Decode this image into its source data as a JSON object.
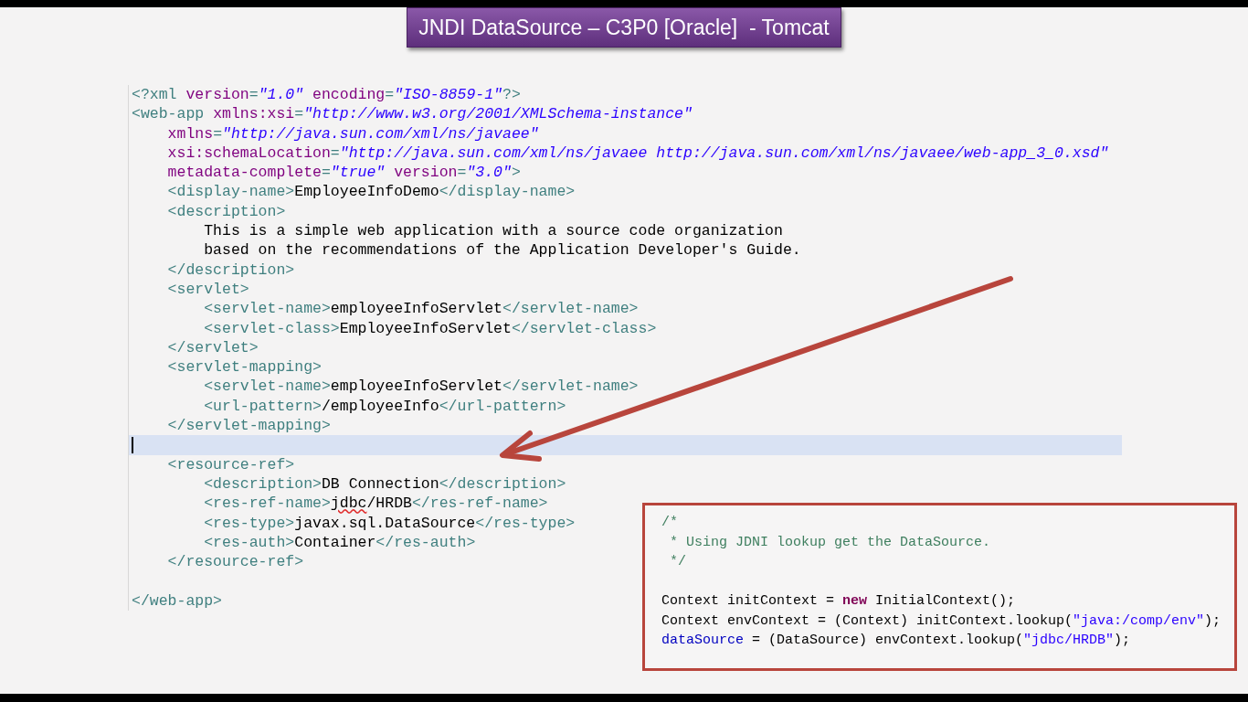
{
  "title": "JNDI DataSource – C3P0 [Oracle]  - Tomcat",
  "editor": {
    "lines": [
      {
        "current": false,
        "tokens": [
          {
            "kind": "tag",
            "text": "<?xml "
          },
          {
            "kind": "attr",
            "text": "version"
          },
          {
            "kind": "tag",
            "text": "="
          },
          {
            "kind": "string",
            "text": "\"1.0\""
          },
          {
            "kind": "attr",
            "text": " encoding"
          },
          {
            "kind": "tag",
            "text": "="
          },
          {
            "kind": "string",
            "text": "\"ISO-8859-1\""
          },
          {
            "kind": "tag",
            "text": "?>"
          }
        ]
      },
      {
        "current": false,
        "tokens": [
          {
            "kind": "tag",
            "text": "<web-app "
          },
          {
            "kind": "attr",
            "text": "xmlns:xsi"
          },
          {
            "kind": "tag",
            "text": "="
          },
          {
            "kind": "string",
            "text": "\"http://www.w3.org/2001/XMLSchema-instance\""
          }
        ]
      },
      {
        "current": false,
        "tokens": [
          {
            "kind": "attr",
            "text": "    xmlns"
          },
          {
            "kind": "tag",
            "text": "="
          },
          {
            "kind": "string",
            "text": "\"http://java.sun.com/xml/ns/javaee\""
          }
        ]
      },
      {
        "current": false,
        "tokens": [
          {
            "kind": "attr",
            "text": "    xsi:schemaLocation"
          },
          {
            "kind": "tag",
            "text": "="
          },
          {
            "kind": "string",
            "text": "\"http://java.sun.com/xml/ns/javaee http://java.sun.com/xml/ns/javaee/web-app_3_0.xsd\""
          }
        ]
      },
      {
        "current": false,
        "tokens": [
          {
            "kind": "attr",
            "text": "    metadata-complete"
          },
          {
            "kind": "tag",
            "text": "="
          },
          {
            "kind": "string",
            "text": "\"true\""
          },
          {
            "kind": "attr",
            "text": " version"
          },
          {
            "kind": "tag",
            "text": "="
          },
          {
            "kind": "string",
            "text": "\"3.0\""
          },
          {
            "kind": "tag",
            "text": ">"
          }
        ]
      },
      {
        "current": false,
        "tokens": [
          {
            "kind": "tag",
            "text": "    <display-name>"
          },
          {
            "kind": "text",
            "text": "EmployeeInfoDemo"
          },
          {
            "kind": "tag",
            "text": "</display-name>"
          }
        ]
      },
      {
        "current": false,
        "tokens": [
          {
            "kind": "tag",
            "text": "    <description>"
          }
        ]
      },
      {
        "current": false,
        "tokens": [
          {
            "kind": "text",
            "text": "        This is a simple web application with a source code organization"
          }
        ]
      },
      {
        "current": false,
        "tokens": [
          {
            "kind": "text",
            "text": "        based on the recommendations of the Application Developer's Guide."
          }
        ]
      },
      {
        "current": false,
        "tokens": [
          {
            "kind": "tag",
            "text": "    </description>"
          }
        ]
      },
      {
        "current": false,
        "tokens": [
          {
            "kind": "tag",
            "text": "    <servlet>"
          }
        ]
      },
      {
        "current": false,
        "tokens": [
          {
            "kind": "tag",
            "text": "        <servlet-name>"
          },
          {
            "kind": "text",
            "text": "employeeInfoServlet"
          },
          {
            "kind": "tag",
            "text": "</servlet-name>"
          }
        ]
      },
      {
        "current": false,
        "tokens": [
          {
            "kind": "tag",
            "text": "        <servlet-class>"
          },
          {
            "kind": "text",
            "text": "EmployeeInfoServlet"
          },
          {
            "kind": "tag",
            "text": "</servlet-class>"
          }
        ]
      },
      {
        "current": false,
        "tokens": [
          {
            "kind": "tag",
            "text": "    </servlet>"
          }
        ]
      },
      {
        "current": false,
        "tokens": [
          {
            "kind": "tag",
            "text": "    <servlet-mapping>"
          }
        ]
      },
      {
        "current": false,
        "tokens": [
          {
            "kind": "tag",
            "text": "        <servlet-name>"
          },
          {
            "kind": "text",
            "text": "employeeInfoServlet"
          },
          {
            "kind": "tag",
            "text": "</servlet-name>"
          }
        ]
      },
      {
        "current": false,
        "tokens": [
          {
            "kind": "tag",
            "text": "        <url-pattern>"
          },
          {
            "kind": "text",
            "text": "/employeeInfo"
          },
          {
            "kind": "tag",
            "text": "</url-pattern>"
          }
        ]
      },
      {
        "current": false,
        "tokens": [
          {
            "kind": "tag",
            "text": "    </servlet-mapping>"
          }
        ]
      },
      {
        "current": true
      },
      {
        "current": false,
        "tokens": [
          {
            "kind": "tag",
            "text": "    <resource-ref>"
          }
        ]
      },
      {
        "current": false,
        "tokens": [
          {
            "kind": "tag",
            "text": "        <description>"
          },
          {
            "kind": "text",
            "text": "DB Connection"
          },
          {
            "kind": "tag",
            "text": "</description>"
          }
        ]
      },
      {
        "current": false,
        "tokens": [
          {
            "kind": "tag",
            "text": "        <res-ref-name>"
          },
          {
            "kind": "misspelled",
            "text": "jdbc"
          },
          {
            "kind": "text",
            "text": "/HRDB"
          },
          {
            "kind": "tag",
            "text": "</res-ref-name>"
          }
        ]
      },
      {
        "current": false,
        "tokens": [
          {
            "kind": "tag",
            "text": "        <res-type>"
          },
          {
            "kind": "text",
            "text": "javax.sql.DataSource"
          },
          {
            "kind": "tag",
            "text": "</res-type>"
          }
        ]
      },
      {
        "current": false,
        "tokens": [
          {
            "kind": "tag",
            "text": "        <res-auth>"
          },
          {
            "kind": "text",
            "text": "Container"
          },
          {
            "kind": "tag",
            "text": "</res-auth>"
          }
        ]
      },
      {
        "current": false,
        "tokens": [
          {
            "kind": "tag",
            "text": "    </resource-ref>"
          }
        ]
      },
      {
        "current": false
      },
      {
        "current": false,
        "tokens": [
          {
            "kind": "tag",
            "text": "</web-app>"
          }
        ]
      }
    ]
  },
  "snippet": {
    "comment_lines": [
      {
        "tokens": [
          {
            "kind": "comment",
            "text": "/*"
          }
        ]
      },
      {
        "tokens": [
          {
            "kind": "comment",
            "text": " * Using JDNI lookup get the DataSource."
          }
        ]
      },
      {
        "tokens": [
          {
            "kind": "comment",
            "text": " */"
          }
        ]
      }
    ],
    "code_lines": [
      {
        "tokens": [
          {
            "kind": "text",
            "text": "Context initContext = "
          },
          {
            "kind": "keyword",
            "text": "new"
          },
          {
            "kind": "text",
            "text": " InitialContext();"
          }
        ]
      },
      {
        "tokens": [
          {
            "kind": "text",
            "text": "Context envContext = (Context) initContext.lookup("
          },
          {
            "kind": "string",
            "text": "\"java:/comp/env\""
          },
          {
            "kind": "text",
            "text": ");"
          }
        ]
      },
      {
        "tokens": [
          {
            "kind": "field",
            "text": "dataSource"
          },
          {
            "kind": "text",
            "text": " = (DataSource) envContext.lookup("
          },
          {
            "kind": "string",
            "text": "\"jdbc/HRDB\""
          },
          {
            "kind": "text",
            "text": ");"
          }
        ]
      }
    ]
  }
}
